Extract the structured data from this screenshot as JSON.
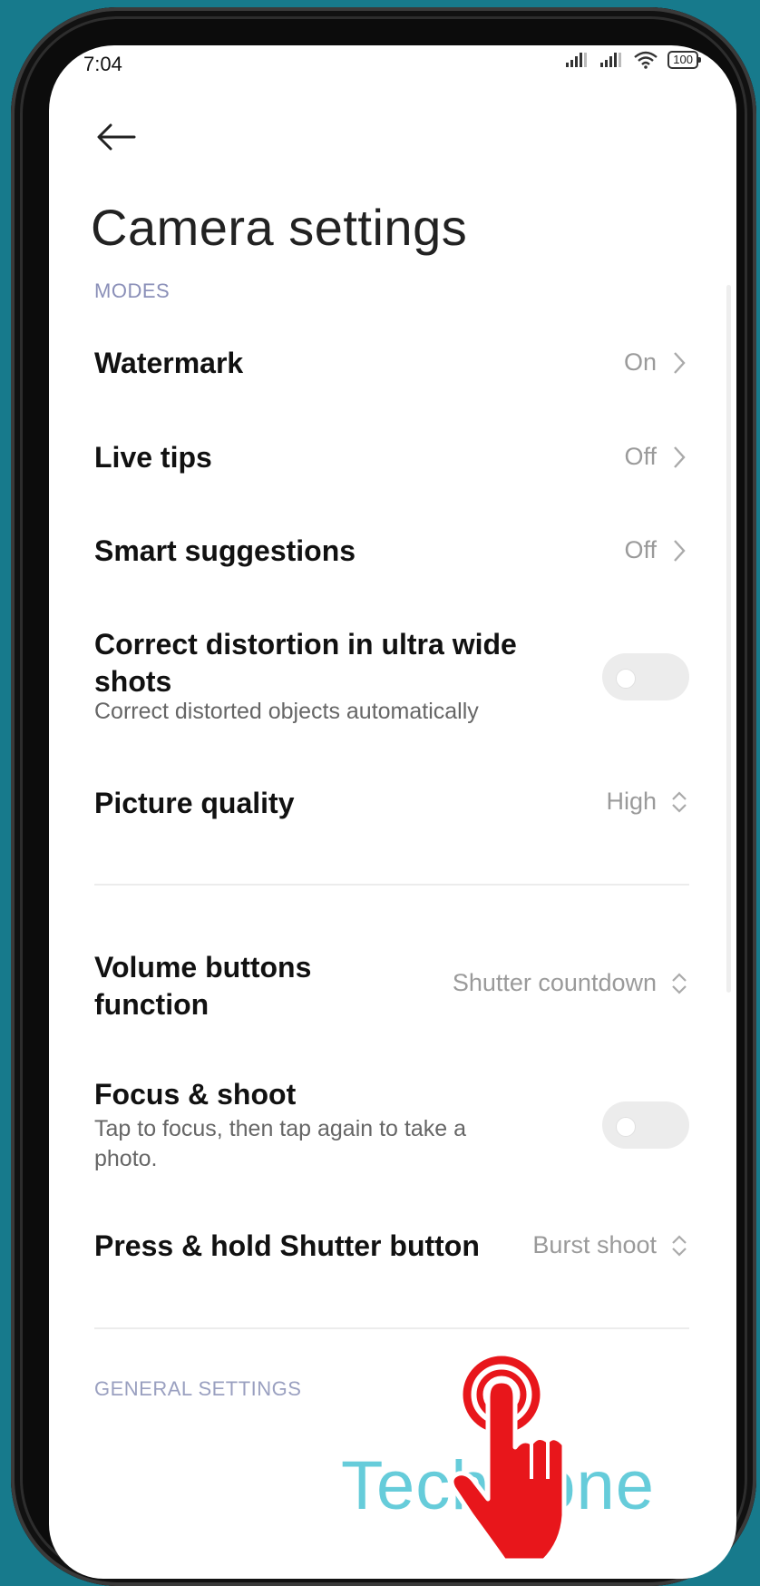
{
  "status_bar": {
    "time": "7:04",
    "battery": "100"
  },
  "header": {
    "title": "Camera settings"
  },
  "sections": {
    "modes": "MODES",
    "general": "GENERAL SETTINGS"
  },
  "rows": {
    "watermark": {
      "title": "Watermark",
      "value": "On"
    },
    "live_tips": {
      "title": "Live tips",
      "value": "Off"
    },
    "smart_suggestions": {
      "title": "Smart suggestions",
      "value": "Off"
    },
    "correct_distortion": {
      "title": "Correct distortion in ultra wide shots",
      "subtitle": "Correct distorted objects automatically",
      "enabled": false
    },
    "picture_quality": {
      "title": "Picture quality",
      "value": "High"
    },
    "volume_buttons": {
      "title": "Volume buttons function",
      "value": "Shutter countdown"
    },
    "focus_shoot": {
      "title": "Focus & shoot",
      "subtitle": "Tap to focus, then tap again to take a photo.",
      "enabled": false
    },
    "press_hold": {
      "title": "Press & hold Shutter button",
      "value": "Burst shoot"
    }
  },
  "watermark_overlay": "TechBone",
  "colors": {
    "background": "#177a8c",
    "section_label": "#8a8fb8",
    "accent_hand": "#e8161b",
    "watermark": "#4cc4d4"
  }
}
